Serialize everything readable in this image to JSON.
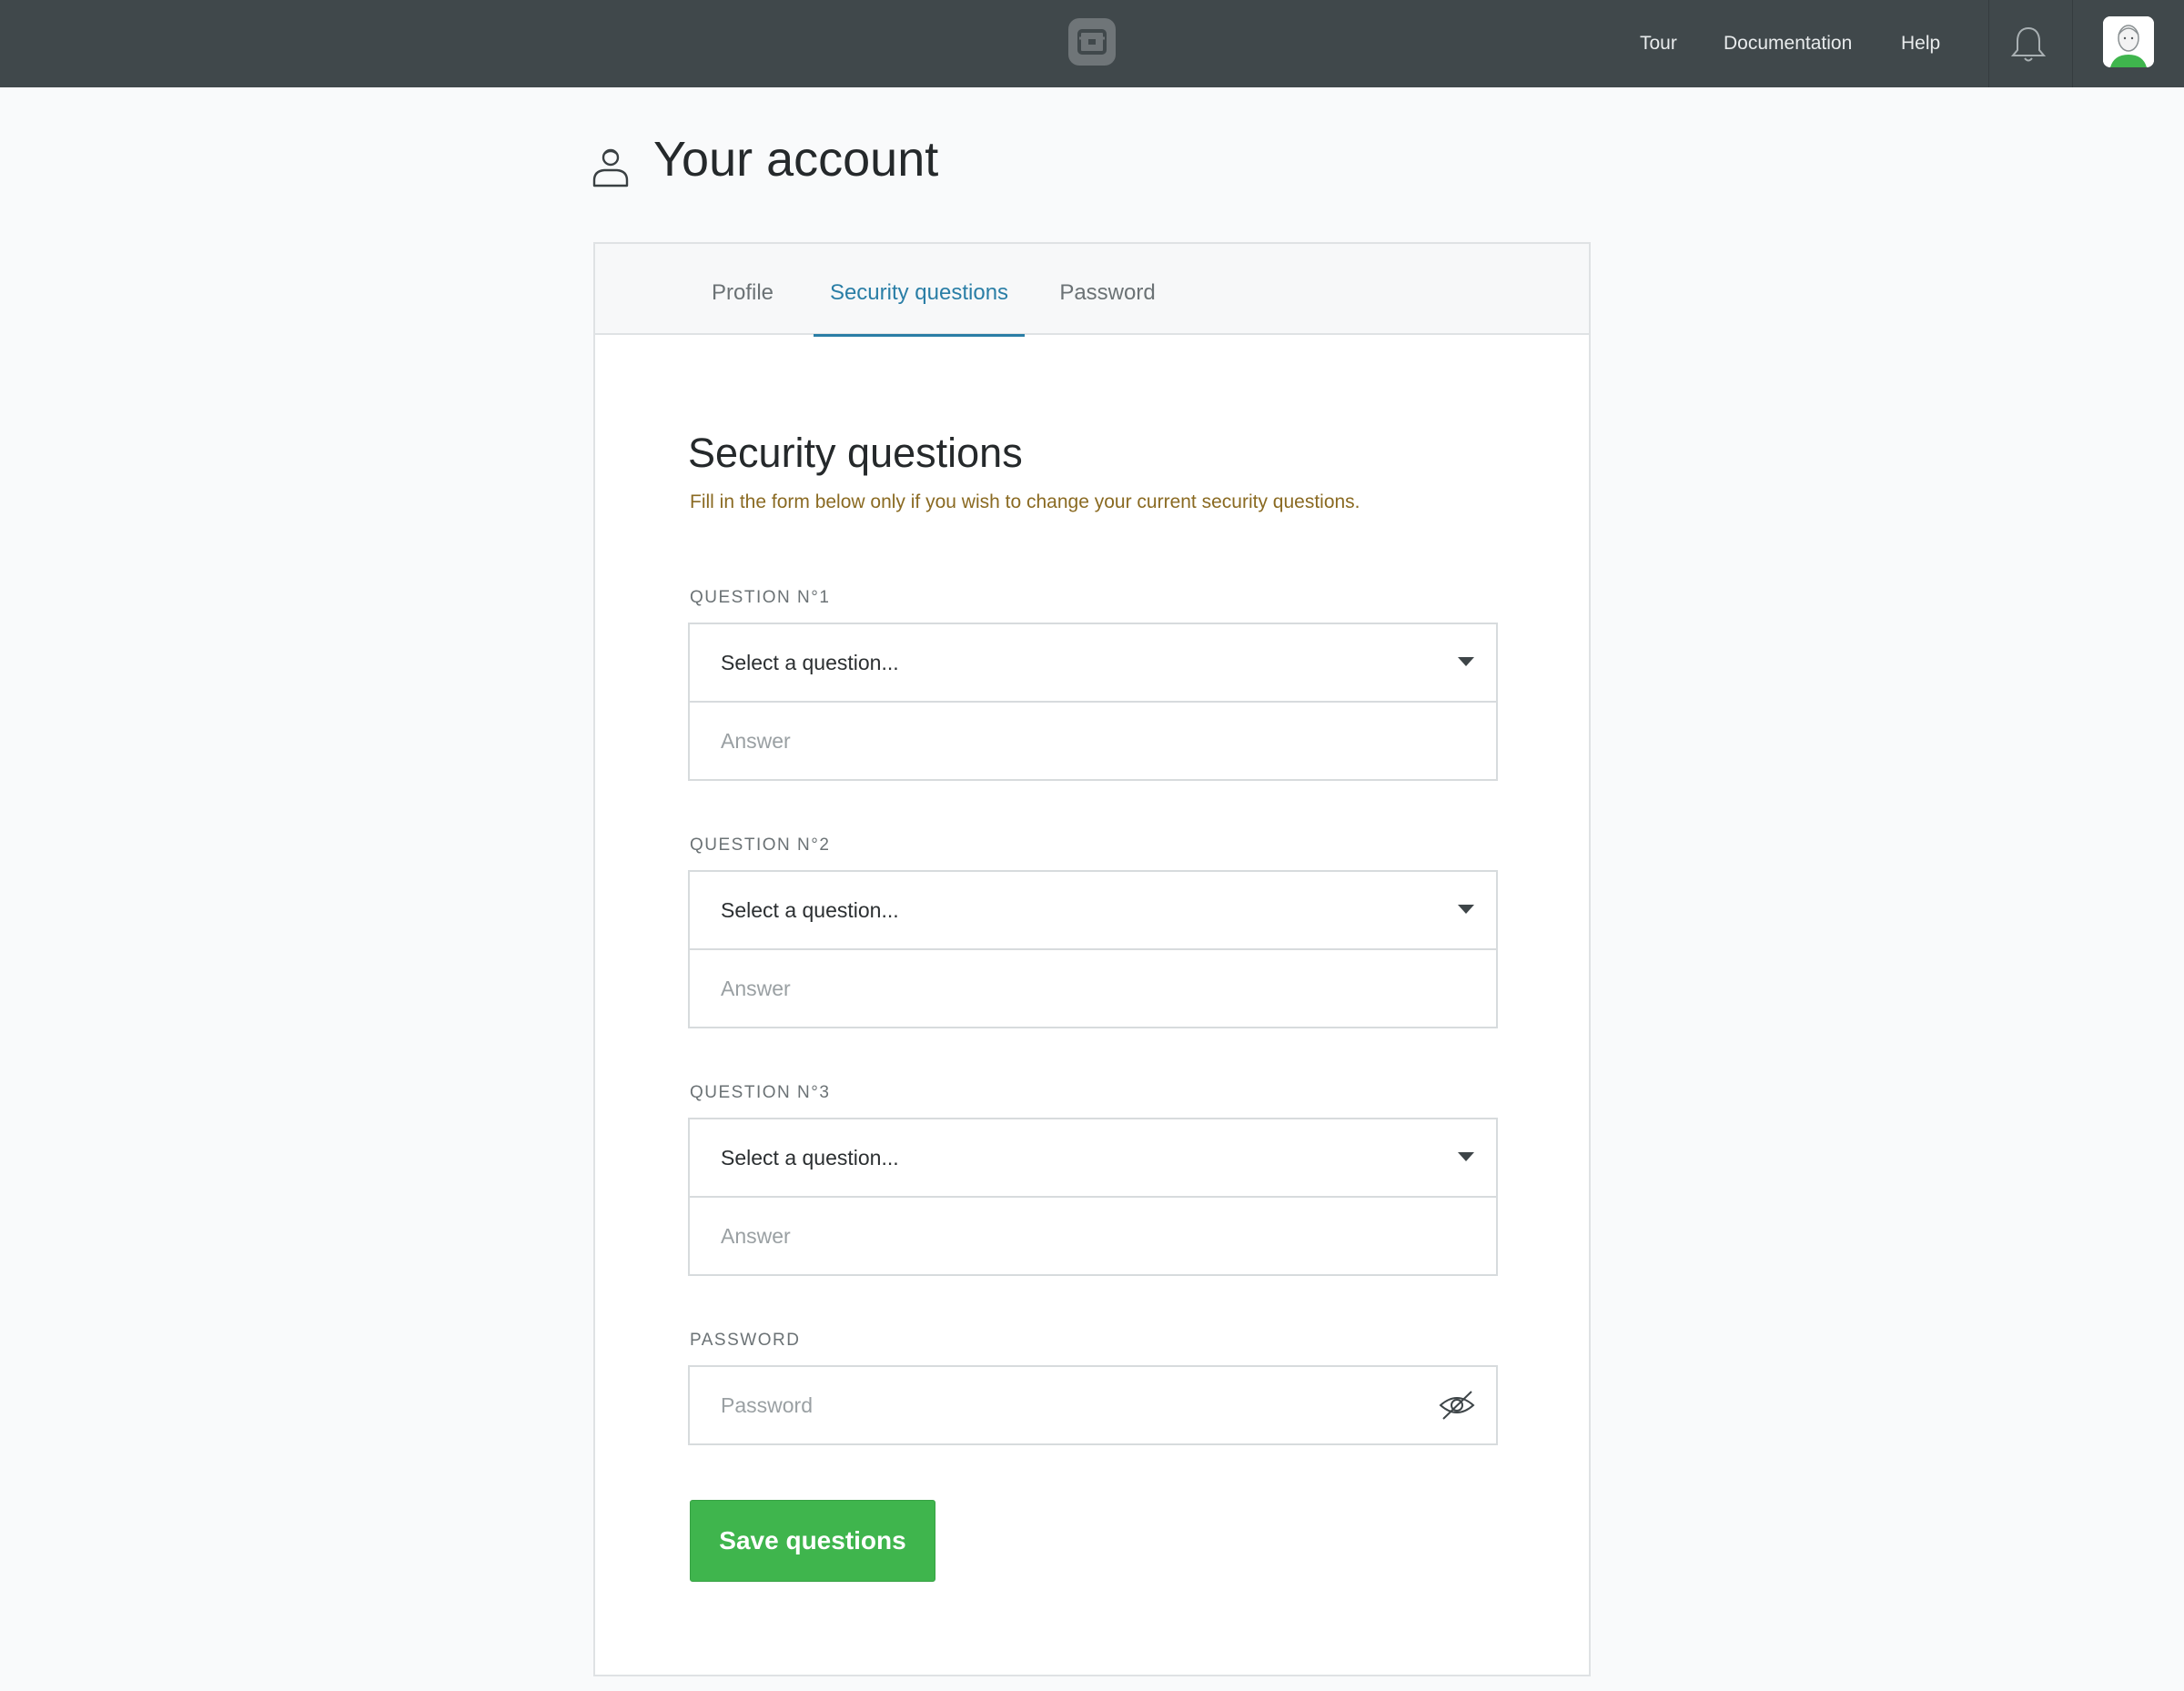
{
  "header": {
    "nav": [
      "Tour",
      "Documentation",
      "Help"
    ]
  },
  "page": {
    "title": "Your account"
  },
  "tabs": [
    {
      "label": "Profile",
      "active": false
    },
    {
      "label": "Security questions",
      "active": true
    },
    {
      "label": "Password",
      "active": false
    }
  ],
  "section": {
    "title": "Security questions",
    "subtitle": "Fill in the form below only if you wish to change your current security questions."
  },
  "questions": [
    {
      "label": "QUESTION N°1",
      "select_value": "Select a question...",
      "answer_placeholder": "Answer"
    },
    {
      "label": "QUESTION N°2",
      "select_value": "Select a question...",
      "answer_placeholder": "Answer"
    },
    {
      "label": "QUESTION N°3",
      "select_value": "Select a question...",
      "answer_placeholder": "Answer"
    }
  ],
  "password": {
    "label": "PASSWORD",
    "placeholder": "Password"
  },
  "save_button": "Save questions",
  "colors": {
    "topbar": "#40484b",
    "accent": "#2a7ea6",
    "button": "#3fb54d",
    "subtitle": "#8a6a22"
  },
  "icons": {
    "logo": "app-logo-icon",
    "notifications": "bell-icon",
    "page": "user-icon",
    "password_toggle": "eye-slash-icon",
    "dropdown": "chevron-down-icon"
  }
}
